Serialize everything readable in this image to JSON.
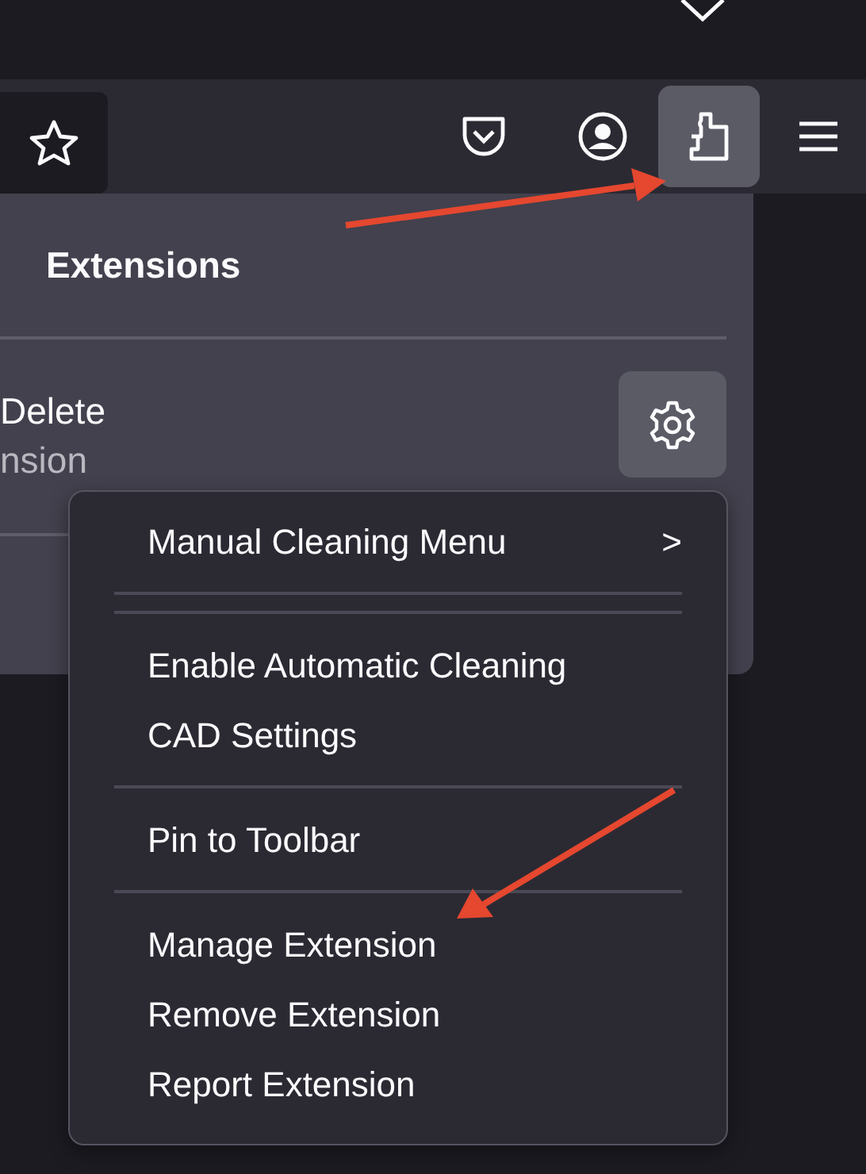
{
  "toolbar": {
    "extensions_selected": true
  },
  "panel": {
    "title": "Extensions",
    "extension": {
      "name": "Delete",
      "subtitle": "nsion"
    }
  },
  "context_menu": [
    {
      "kind": "item",
      "label": "Manual Cleaning Menu",
      "submenu_glyph": ">"
    },
    {
      "kind": "separator"
    },
    {
      "kind": "separator"
    },
    {
      "kind": "item",
      "label": "Enable Automatic Cleaning"
    },
    {
      "kind": "item",
      "label": "CAD Settings"
    },
    {
      "kind": "separator"
    },
    {
      "kind": "item",
      "label": "Pin to Toolbar"
    },
    {
      "kind": "separator"
    },
    {
      "kind": "item",
      "label": "Manage Extension"
    },
    {
      "kind": "item",
      "label": "Remove Extension"
    },
    {
      "kind": "item",
      "label": "Report Extension"
    }
  ]
}
